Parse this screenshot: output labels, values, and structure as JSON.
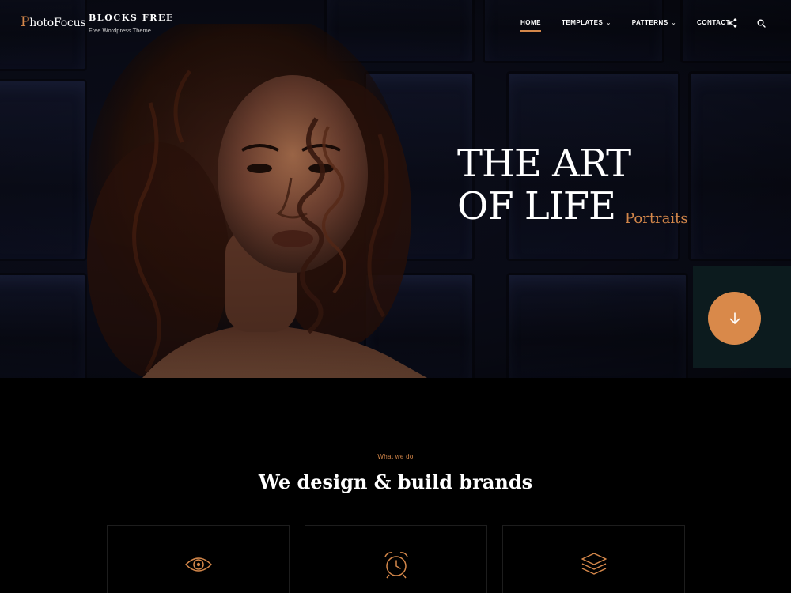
{
  "header": {
    "logo_first": "P",
    "logo_rest": "hotoFocus",
    "site_title": "BLOCKS FREE",
    "tagline": "Free Wordpress Theme",
    "nav": [
      {
        "label": "HOME",
        "active": true,
        "has_dropdown": false
      },
      {
        "label": "TEMPLATES",
        "active": false,
        "has_dropdown": true
      },
      {
        "label": "PATTERNS",
        "active": false,
        "has_dropdown": true
      },
      {
        "label": "CONTACT",
        "active": false,
        "has_dropdown": false
      }
    ],
    "icons": [
      "share-icon",
      "search-icon"
    ]
  },
  "hero": {
    "title_line1": "THE ART",
    "title_line2": "OF LIFE",
    "subtitle": "Portraits",
    "scroll_icon": "arrow-down-icon"
  },
  "section": {
    "eyebrow": "What we do",
    "title": "We design & build brands",
    "cards": [
      {
        "icon": "eye-icon"
      },
      {
        "icon": "alarm-clock-icon"
      },
      {
        "icon": "layers-icon"
      }
    ]
  },
  "colors": {
    "accent": "#d4874a",
    "background": "#000000",
    "hero_bg": "#0b0d1a",
    "scroll_box": "#0c1b1e"
  }
}
